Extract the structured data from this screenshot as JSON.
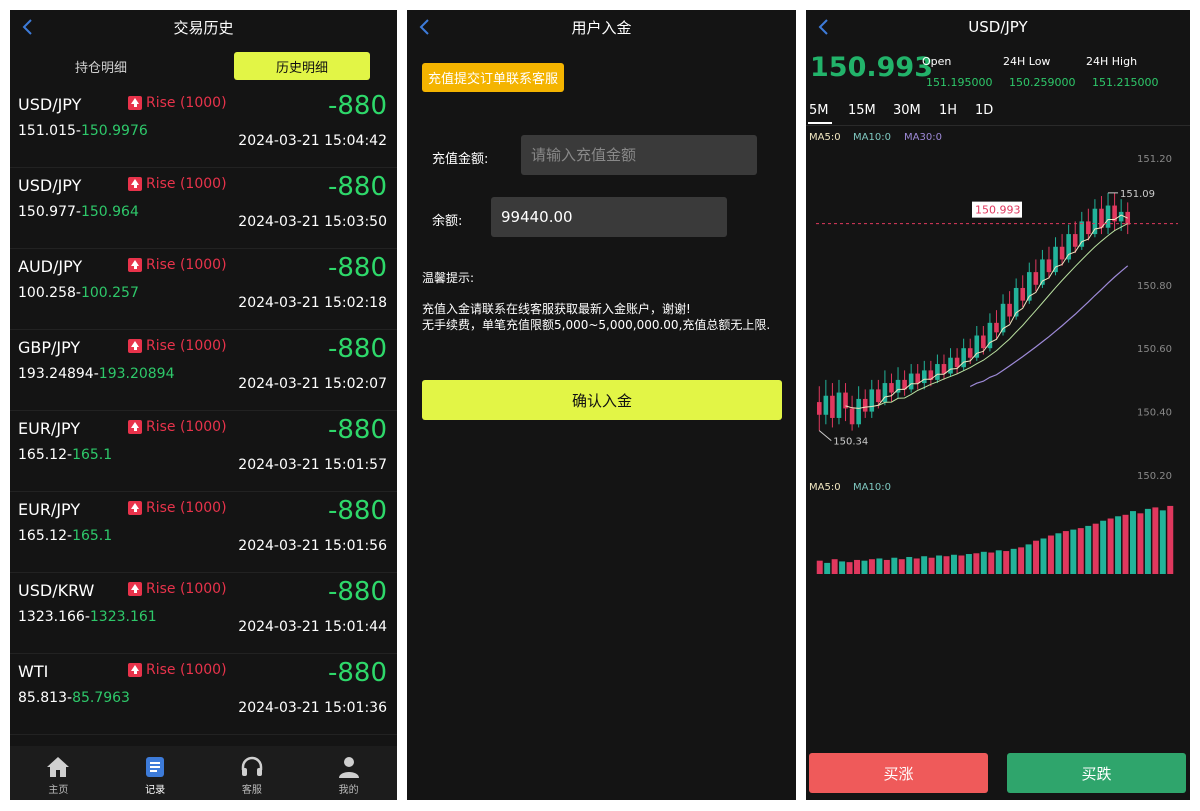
{
  "history": {
    "title": "交易历史",
    "tabs": {
      "holdings": "持仓明细",
      "history": "历史明细"
    },
    "rows": [
      {
        "pair": "USD/JPY",
        "direction": "Rise (1000)",
        "pnl": "-880",
        "open": "151.015",
        "close": "150.9976",
        "time": "2024-03-21 15:04:42"
      },
      {
        "pair": "USD/JPY",
        "direction": "Rise (1000)",
        "pnl": "-880",
        "open": "150.977",
        "close": "150.964",
        "time": "2024-03-21 15:03:50"
      },
      {
        "pair": "AUD/JPY",
        "direction": "Rise (1000)",
        "pnl": "-880",
        "open": "100.258",
        "close": "100.257",
        "time": "2024-03-21 15:02:18"
      },
      {
        "pair": "GBP/JPY",
        "direction": "Rise (1000)",
        "pnl": "-880",
        "open": "193.24894",
        "close": "193.20894",
        "time": "2024-03-21 15:02:07"
      },
      {
        "pair": "EUR/JPY",
        "direction": "Rise (1000)",
        "pnl": "-880",
        "open": "165.12",
        "close": "165.1",
        "time": "2024-03-21 15:01:57"
      },
      {
        "pair": "EUR/JPY",
        "direction": "Rise (1000)",
        "pnl": "-880",
        "open": "165.12",
        "close": "165.1",
        "time": "2024-03-21 15:01:56"
      },
      {
        "pair": "USD/KRW",
        "direction": "Rise (1000)",
        "pnl": "-880",
        "open": "1323.166",
        "close": "1323.161",
        "time": "2024-03-21 15:01:44"
      },
      {
        "pair": "WTI",
        "direction": "Rise (1000)",
        "pnl": "-880",
        "open": "85.813",
        "close": "85.7963",
        "time": "2024-03-21 15:01:36"
      }
    ],
    "nav": [
      {
        "label": "主页",
        "icon": "home-icon"
      },
      {
        "label": "记录",
        "icon": "records-icon"
      },
      {
        "label": "客服",
        "icon": "headset-icon"
      },
      {
        "label": "我的",
        "icon": "user-icon"
      }
    ],
    "colors": {
      "accent": "#e2f546",
      "loss": "#2ed86a",
      "rise": "#e8334b"
    }
  },
  "deposit": {
    "title": "用户入金",
    "notice_button": "充值提交订单联系客服",
    "amount_label": "充值金额:",
    "amount_placeholder": "请输入充值金额",
    "balance_label": "余额:",
    "balance_value": "99440.00",
    "tip_title": "温馨提示:",
    "tip_line1": "充值入金请联系在线客服获取最新入金账户，谢谢!",
    "tip_line2": "无手续费，单笔充值限额5,000~5,000,000.00,充值总额无上限.",
    "confirm_button": "确认入金"
  },
  "chart": {
    "title": "USD/JPY",
    "price": "150.993",
    "open_label": "Open",
    "open_value": "151.195000",
    "low_label": "24H Low",
    "low_value": "150.259000",
    "high_label": "24H High",
    "high_value": "151.215000",
    "timeframes": [
      "5M",
      "15M",
      "30M",
      "1H",
      "1D"
    ],
    "ma_labels": {
      "ma5": "MA5:0",
      "ma10": "MA10:0",
      "ma30": "MA30:0"
    },
    "vol_ma_labels": {
      "ma5": "MA5:0",
      "ma10": "MA10:0"
    },
    "buy_up": "买涨",
    "buy_down": "买跌",
    "current_price_tag": "150.993",
    "min_annotation": "150.34",
    "max_annotation": "151.09",
    "colors": {
      "up": "#22b39a",
      "down": "#e0385e",
      "ma5": "#f0e6c0",
      "ma10": "#b9e0a0",
      "ma30": "#9e8ad8"
    }
  },
  "chart_data": {
    "type": "candlestick",
    "ylim": [
      150.2,
      151.2
    ],
    "yticks": [
      "151.20",
      "150.80",
      "150.60",
      "150.40",
      "150.20"
    ],
    "current_price": 150.993,
    "candles": [
      [
        150.43,
        150.39,
        150.48,
        150.34
      ],
      [
        150.39,
        150.45,
        150.5,
        150.36
      ],
      [
        150.45,
        150.38,
        150.49,
        150.35
      ],
      [
        150.38,
        150.46,
        150.5,
        150.36
      ],
      [
        150.46,
        150.41,
        150.49,
        150.37
      ],
      [
        150.41,
        150.36,
        150.45,
        150.34
      ],
      [
        150.36,
        150.44,
        150.48,
        150.35
      ],
      [
        150.44,
        150.4,
        150.47,
        150.38
      ],
      [
        150.4,
        150.47,
        150.5,
        150.38
      ],
      [
        150.47,
        150.43,
        150.5,
        150.41
      ],
      [
        150.43,
        150.49,
        150.53,
        150.42
      ],
      [
        150.49,
        150.46,
        150.52,
        150.43
      ],
      [
        150.46,
        150.5,
        150.54,
        150.44
      ],
      [
        150.5,
        150.47,
        150.53,
        150.45
      ],
      [
        150.47,
        150.52,
        150.55,
        150.46
      ],
      [
        150.52,
        150.49,
        150.55,
        150.47
      ],
      [
        150.49,
        150.53,
        150.56,
        150.47
      ],
      [
        150.53,
        150.5,
        150.56,
        150.48
      ],
      [
        150.5,
        150.55,
        150.58,
        150.49
      ],
      [
        150.55,
        150.52,
        150.58,
        150.5
      ],
      [
        150.52,
        150.57,
        150.6,
        150.51
      ],
      [
        150.57,
        150.54,
        150.6,
        150.52
      ],
      [
        150.54,
        150.6,
        150.63,
        150.53
      ],
      [
        150.6,
        150.57,
        150.63,
        150.55
      ],
      [
        150.57,
        150.64,
        150.67,
        150.56
      ],
      [
        150.64,
        150.6,
        150.67,
        150.58
      ],
      [
        150.6,
        150.68,
        150.71,
        150.59
      ],
      [
        150.68,
        150.65,
        150.72,
        150.63
      ],
      [
        150.65,
        150.74,
        150.77,
        150.64
      ],
      [
        150.74,
        150.7,
        150.78,
        150.68
      ],
      [
        150.7,
        150.79,
        150.82,
        150.69
      ],
      [
        150.79,
        150.75,
        150.83,
        150.73
      ],
      [
        150.75,
        150.84,
        150.87,
        150.74
      ],
      [
        150.84,
        150.8,
        150.88,
        150.78
      ],
      [
        150.8,
        150.88,
        150.91,
        150.79
      ],
      [
        150.88,
        150.84,
        150.92,
        150.82
      ],
      [
        150.84,
        150.92,
        150.95,
        150.83
      ],
      [
        150.92,
        150.88,
        150.96,
        150.86
      ],
      [
        150.88,
        150.96,
        150.99,
        150.87
      ],
      [
        150.96,
        150.92,
        151,
        150.9
      ],
      [
        150.92,
        151,
        151.03,
        150.91
      ],
      [
        151,
        150.96,
        151.04,
        150.94
      ],
      [
        150.96,
        151.04,
        151.07,
        150.95
      ],
      [
        151.04,
        150.98,
        151.08,
        150.96
      ],
      [
        150.98,
        151.05,
        151.09,
        150.96
      ],
      [
        151.05,
        151,
        151.09,
        150.97
      ],
      [
        151,
        151.03,
        151.07,
        150.97
      ],
      [
        151.03,
        150.99,
        151.06,
        150.96
      ]
    ],
    "volume_levels": [
      0.18,
      0.15,
      0.2,
      0.17,
      0.16,
      0.19,
      0.18,
      0.2,
      0.21,
      0.19,
      0.22,
      0.2,
      0.23,
      0.21,
      0.24,
      0.22,
      0.25,
      0.24,
      0.26,
      0.25,
      0.27,
      0.28,
      0.3,
      0.29,
      0.32,
      0.31,
      0.34,
      0.36,
      0.4,
      0.45,
      0.48,
      0.52,
      0.55,
      0.58,
      0.6,
      0.62,
      0.65,
      0.68,
      0.72,
      0.75,
      0.78,
      0.8,
      0.85,
      0.82,
      0.88,
      0.9,
      0.86,
      0.92
    ]
  }
}
